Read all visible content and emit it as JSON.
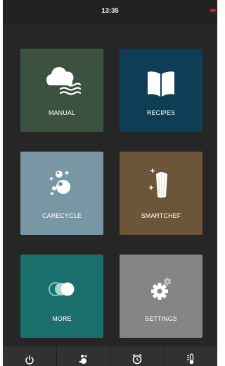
{
  "status_bar": {
    "time": "13:35",
    "cloud_indicator_color": "#c8252c"
  },
  "tiles": [
    {
      "label": "MANUAL",
      "icon": "steam-cloud-icon",
      "color": "#3c5240"
    },
    {
      "label": "RECIPES",
      "icon": "book-icon",
      "color": "#0d3e56"
    },
    {
      "label": "CARECYCLE",
      "icon": "bubbles-icon",
      "color": "#7896a4"
    },
    {
      "label": "SMARTCHEF",
      "icon": "chef-hat-icon",
      "color": "#6b5639"
    },
    {
      "label": "MORE",
      "icon": "toggle-circles-icon",
      "color": "#1b6f6c"
    },
    {
      "label": "SETTINGS",
      "icon": "gear-icon",
      "color": "#858585"
    }
  ],
  "bottom_bar": [
    {
      "icon": "power-icon"
    },
    {
      "icon": "cleaning-icon"
    },
    {
      "icon": "alarm-clock-icon"
    },
    {
      "icon": "temperature-icon"
    }
  ]
}
